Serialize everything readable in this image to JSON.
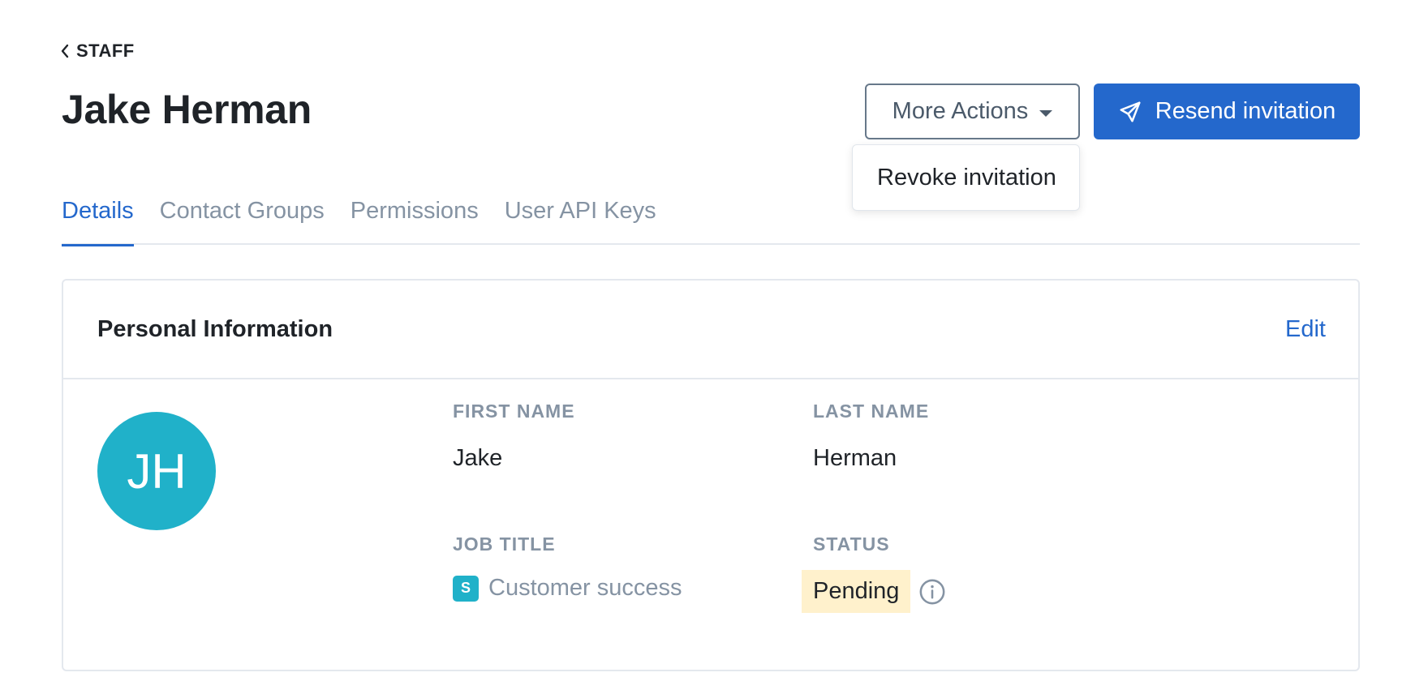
{
  "breadcrumb": {
    "label": "STAFF"
  },
  "page": {
    "title": "Jake Herman"
  },
  "actions": {
    "more_actions_label": "More Actions",
    "resend_label": "Resend invitation",
    "dropdown_items": [
      "Revoke invitation"
    ]
  },
  "tabs": [
    {
      "label": "Details",
      "active": true
    },
    {
      "label": "Contact Groups",
      "active": false
    },
    {
      "label": "Permissions",
      "active": false
    },
    {
      "label": "User API Keys",
      "active": false
    }
  ],
  "card": {
    "title": "Personal Information",
    "edit_label": "Edit",
    "avatar_initials": "JH",
    "fields": {
      "first_name": {
        "label": "FIRST NAME",
        "value": "Jake"
      },
      "last_name": {
        "label": "LAST NAME",
        "value": "Herman"
      },
      "job_title": {
        "label": "JOB TITLE",
        "badge": "S",
        "value": "Customer success"
      },
      "status": {
        "label": "STATUS",
        "value": "Pending"
      }
    }
  },
  "colors": {
    "primary": "#2468cc",
    "avatar": "#20b1c9",
    "status_pending_bg": "#fff1cc",
    "muted_text": "#8593a3"
  },
  "icons": {
    "back": "chevron-left-icon",
    "caret": "caret-down-icon",
    "send": "paper-plane-icon",
    "info": "info-circle-icon"
  }
}
